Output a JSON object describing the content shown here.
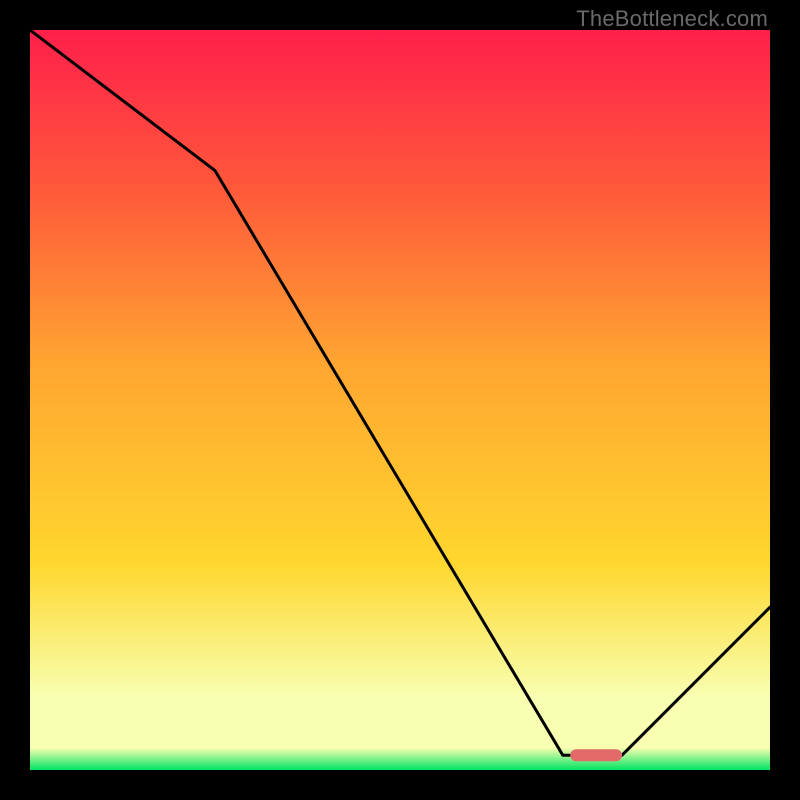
{
  "watermark": "TheBottleneck.com",
  "colors": {
    "grad_top": "#ff1f4b",
    "grad_mid1": "#ff5a3a",
    "grad_mid2": "#ffa531",
    "grad_mid3": "#ffd72e",
    "grad_pale": "#f8ffb0",
    "grad_green": "#00e463",
    "line": "#000000",
    "marker": "#e46a6a",
    "bg": "#000000"
  },
  "chart_data": {
    "type": "line",
    "title": "",
    "xlabel": "",
    "ylabel": "",
    "xlim": [
      0,
      100
    ],
    "ylim": [
      0,
      100
    ],
    "x": [
      0,
      25,
      72,
      80,
      100
    ],
    "values": [
      100,
      81,
      2,
      2,
      22
    ],
    "marker": {
      "x_start": 73,
      "x_end": 80,
      "y": 2
    },
    "annotations": []
  }
}
